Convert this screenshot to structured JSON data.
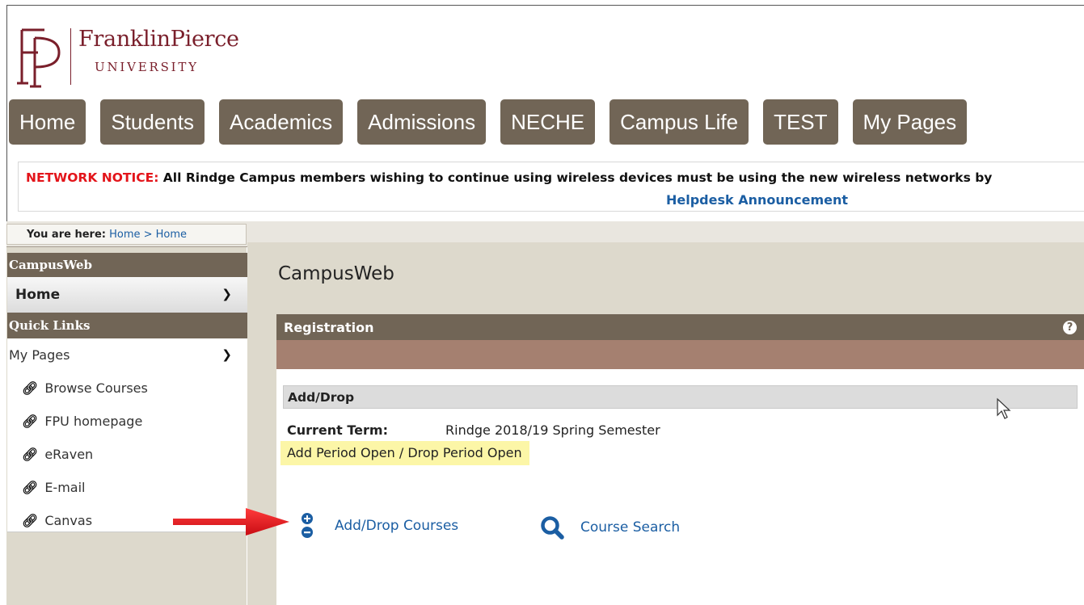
{
  "logo": {
    "monogram": "FP",
    "name": "FranklinPierce",
    "subtitle": "UNIVERSITY"
  },
  "nav": {
    "items": [
      {
        "label": "Home"
      },
      {
        "label": "Students"
      },
      {
        "label": "Academics"
      },
      {
        "label": "Admissions"
      },
      {
        "label": "NECHE"
      },
      {
        "label": "Campus Life"
      },
      {
        "label": "TEST"
      },
      {
        "label": "My Pages"
      }
    ]
  },
  "notice": {
    "label": "NETWORK NOTICE:",
    "text": " All Rindge Campus members wishing to continue using wireless devices must be using the new wireless networks by",
    "link": "Helpdesk Announcement"
  },
  "breadcrumb": {
    "label": "You are here:",
    "path": "Home > Home"
  },
  "sidebar": {
    "header": "CampusWeb",
    "home": "Home",
    "section": "Quick Links",
    "my_pages": "My Pages",
    "links": [
      {
        "label": "Browse Courses"
      },
      {
        "label": "FPU homepage"
      },
      {
        "label": "eRaven"
      },
      {
        "label": "E-mail"
      },
      {
        "label": "Canvas"
      }
    ]
  },
  "main": {
    "title": "CampusWeb",
    "registration": {
      "header": "Registration",
      "help_glyph": "?",
      "subheader": "Add/Drop",
      "term_label": "Current Term:",
      "term_value": "Rindge 2018/19 Spring Semester",
      "period_status": "Add Period Open / Drop Period Open",
      "actions": {
        "add_drop": "Add/Drop Courses",
        "search": "Course Search"
      }
    }
  },
  "colors": {
    "nav_bg": "#716556",
    "brand_maroon": "#7a1f2b",
    "link_blue": "#1b5ea3",
    "notice_red": "#e3141a",
    "band_rose": "#a58070",
    "highlight_yellow": "#fcf6a7",
    "arrow_red": "#e8121b"
  },
  "icons": {
    "link": "link-icon",
    "chevron": "chevron-down-icon",
    "add_drop": "plus-minus-icon",
    "search": "magnifier-icon",
    "help": "question-circle-icon"
  }
}
